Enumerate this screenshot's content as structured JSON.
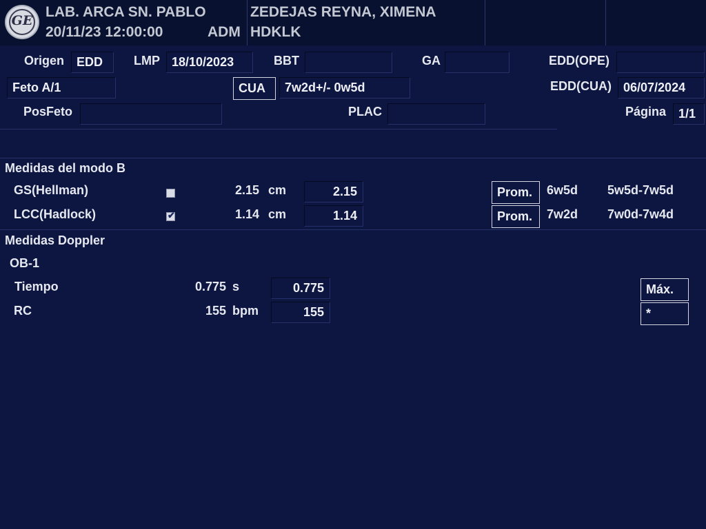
{
  "header": {
    "institution": "LAB. ARCA SN. PABLO",
    "datetime": "20/11/23 12:00:00",
    "operator": "ADM",
    "patient_name": "ZEDEJAS REYNA, XIMENA",
    "patient_id": "HDKLK",
    "logo_text": "GE"
  },
  "patient_info": {
    "origen_label": "Origen",
    "origen_value": "EDD",
    "lmp_label": "LMP",
    "lmp_value": "18/10/2023",
    "bbt_label": "BBT",
    "bbt_value": "",
    "ga_label": "GA",
    "ga_value": "",
    "edd_ope_label": "EDD(OPE)",
    "edd_ope_value": "",
    "feto_value": "Feto A/1",
    "cua_label": "CUA",
    "cua_value": "7w2d+/- 0w5d",
    "edd_cua_label": "EDD(CUA)",
    "edd_cua_value": "06/07/2024",
    "posfeto_label": "PosFeto",
    "posfeto_value": "",
    "plac_label": "PLAC",
    "plac_value": "",
    "pagina_label": "Página",
    "pagina_value": "1/1"
  },
  "bmode": {
    "title": "Medidas del modo B",
    "rows": [
      {
        "name": "GS(Hellman)",
        "checked": false,
        "value": "2.15",
        "unit": "cm",
        "field": "2.15",
        "button": "Prom.",
        "ga": "6w5d",
        "range": "5w5d-7w5d"
      },
      {
        "name": "LCC(Hadlock)",
        "checked": true,
        "value": "1.14",
        "unit": "cm",
        "field": "1.14",
        "button": "Prom.",
        "ga": "7w2d",
        "range": "7w0d-7w4d"
      }
    ]
  },
  "doppler": {
    "title": "Medidas Doppler",
    "subtitle": "OB-1",
    "rows": [
      {
        "name": "Tiempo",
        "value": "0.775",
        "unit": "s",
        "field": "0.775",
        "button": "Máx."
      },
      {
        "name": "RC",
        "value": "155",
        "unit": "bpm",
        "field": "155",
        "button": "*"
      }
    ]
  },
  "colors": {
    "background": "#0c1640",
    "header_background": "#081230",
    "text": "#e6e8ef",
    "header_text": "#c4c8d3"
  }
}
